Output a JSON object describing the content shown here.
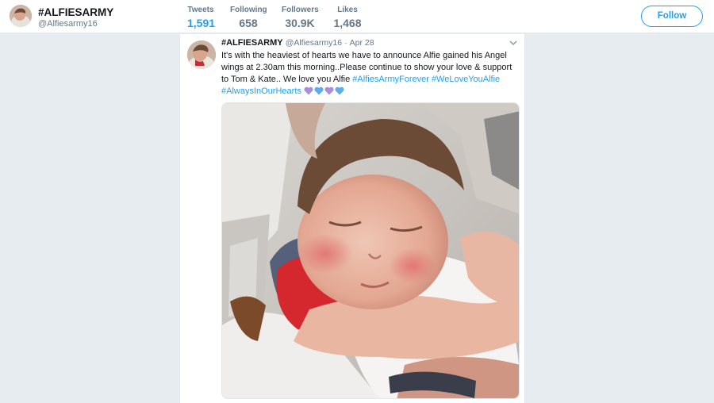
{
  "profile": {
    "name": "#ALFIESARMY",
    "handle": "@Alfiesarmy16"
  },
  "nav_stats": [
    {
      "label": "Tweets",
      "value": "1,591",
      "active": true
    },
    {
      "label": "Following",
      "value": "658",
      "active": false
    },
    {
      "label": "Followers",
      "value": "30.9K",
      "active": false
    },
    {
      "label": "Likes",
      "value": "1,468",
      "active": false
    }
  ],
  "follow_label": "Follow",
  "tweet": {
    "name": "#ALFIESARMY",
    "handle": "@Alfiesarmy16",
    "separator": "·",
    "date": "Apr 28",
    "text_line_1": "It's with the heaviest of hearts we have to announce Alfie gained his Angel wings at 2.30am this morning..Please continue to show your love & support to Tom & Kate.. We love you Alfie ",
    "hashtags": [
      "#AlfiesArmyForever",
      "#WeLoveYouAlfie",
      "#AlwaysInOurHearts"
    ],
    "hearts": [
      "purple-heart",
      "blue-heart",
      "purple-heart",
      "blue-heart"
    ],
    "media_icon": "photo-of-sleeping-child"
  },
  "colors": {
    "accent": "#1da1f2",
    "background": "#e6ecf0",
    "muted": "#657786",
    "purple_heart": "#aa8ed6",
    "blue_heart": "#5dadec"
  }
}
